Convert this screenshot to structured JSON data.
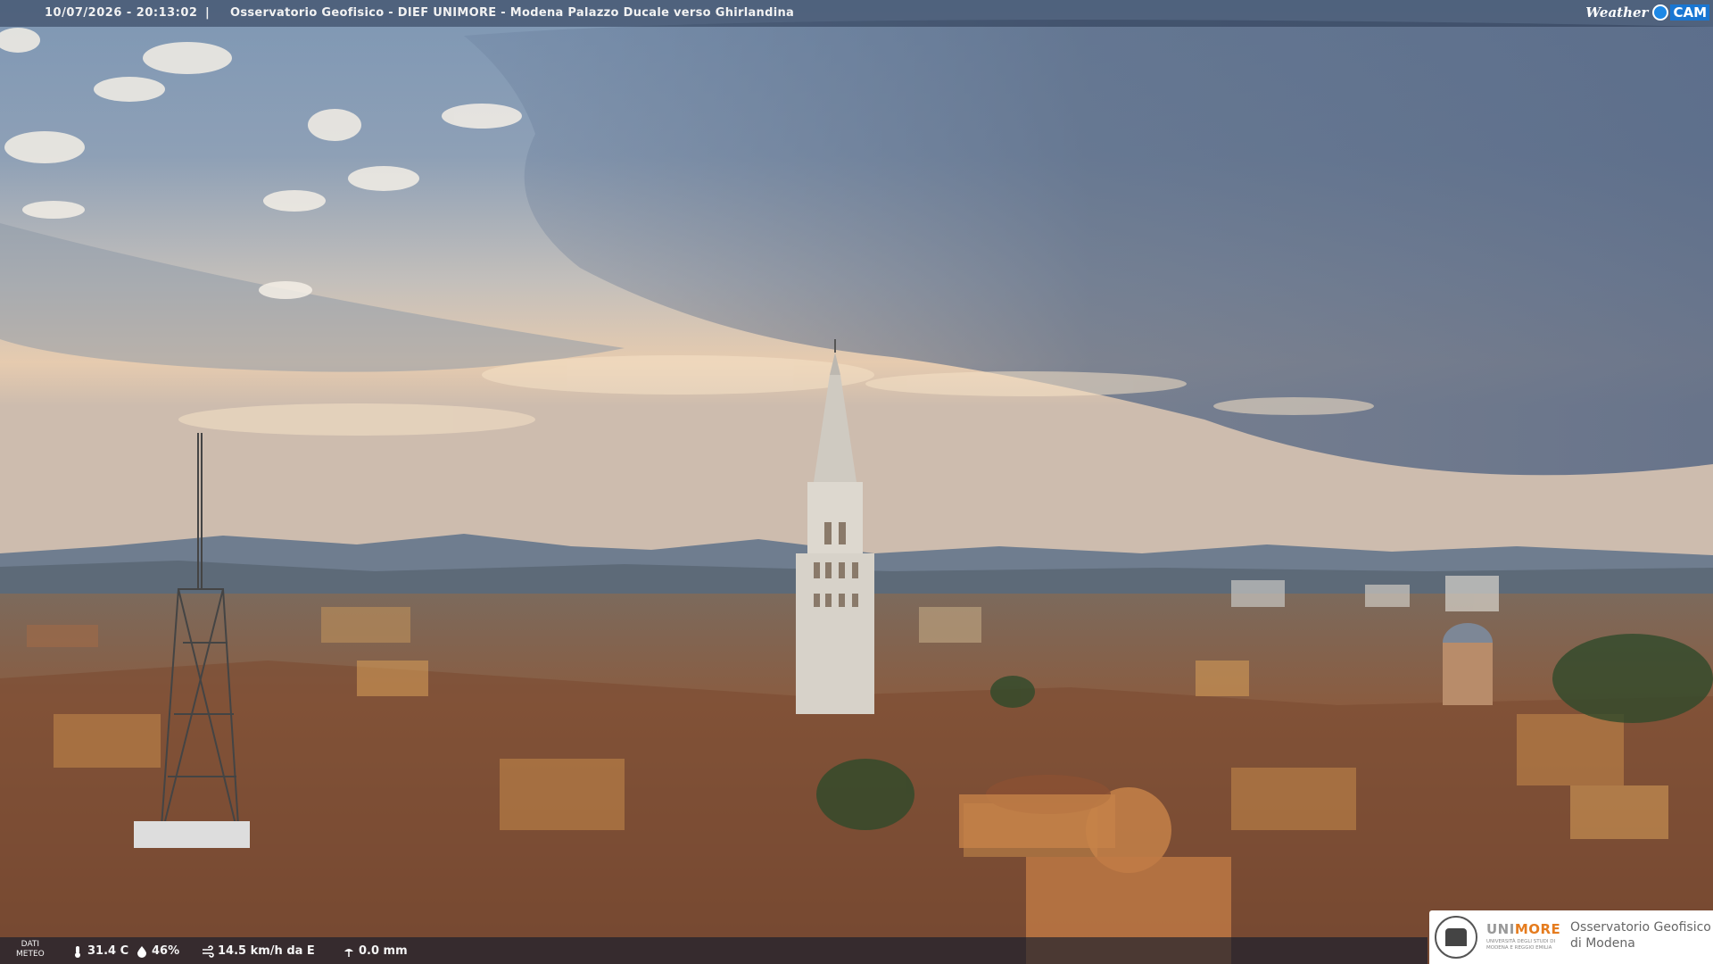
{
  "overlay": {
    "datetime": "10/07/2026 - 20:13:02",
    "separator": "|",
    "title": "Osservatorio Geofisico - DIEF UNIMORE - Modena Palazzo Ducale verso Ghirlandina",
    "brand_weather": "Weather",
    "brand_cam": "CAM"
  },
  "meteo": {
    "label_line1": "DATI",
    "label_line2": "METEO",
    "temperature": "31.4 C",
    "humidity": "46%",
    "wind": "14.5 km/h da E",
    "rain": "0.0 mm"
  },
  "logo": {
    "uni": "UNI",
    "more": "MORE",
    "uni_subtitle": "UNIVERSITÀ DEGLI STUDI DI MODENA E REGGIO EMILIA",
    "observatory_line1": "Osservatorio Geofisico",
    "observatory_line2": "di Modena"
  },
  "colors": {
    "sky_top": "#6e88a6",
    "sky_mid": "#c9c0b5",
    "sky_horizon": "#e8c9a8",
    "mountains": "#6b7a8c",
    "roofs": "#8a5a3a",
    "tower": "#d8d4cc",
    "unimore_orange": "#e57c1f"
  }
}
